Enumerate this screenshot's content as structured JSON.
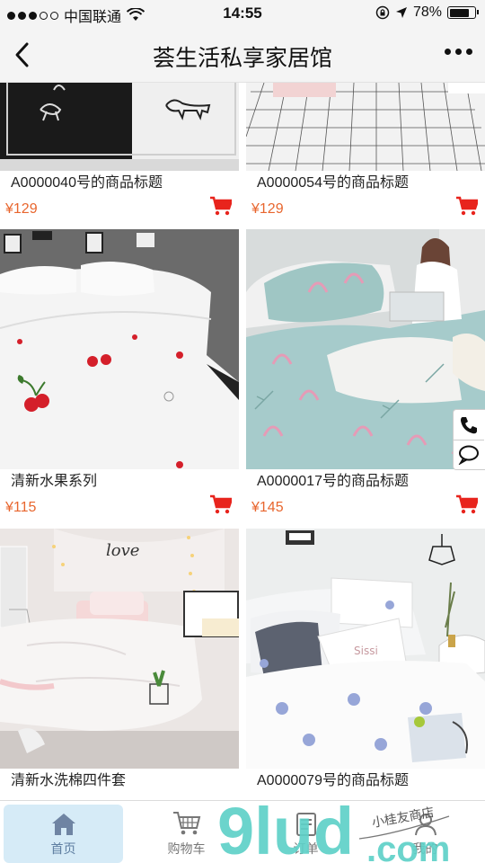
{
  "status_bar": {
    "carrier": "中国联通",
    "time": "14:55",
    "battery": "78%",
    "battery_level": 0.78
  },
  "nav": {
    "title": "荟生活私享家居馆"
  },
  "products": [
    {
      "title": "A0000040号的商品标题",
      "price": "¥129"
    },
    {
      "title": "A0000054号的商品标题",
      "price": "¥129"
    },
    {
      "title": "清新水果系列",
      "price": "¥115"
    },
    {
      "title": "A0000017号的商品标题",
      "price": "¥145"
    },
    {
      "title": "清新水洗棉四件套",
      "price": ""
    },
    {
      "title": "A0000079号的商品标题",
      "price": ""
    }
  ],
  "tabs": [
    {
      "label": "首页",
      "icon": "home-icon",
      "active": true
    },
    {
      "label": "购物车",
      "icon": "cart-icon",
      "active": false
    },
    {
      "label": "订单",
      "icon": "order-icon",
      "active": false
    },
    {
      "label": "我的",
      "icon": "user-icon",
      "active": false
    }
  ],
  "watermark": {
    "text": "9lud",
    "suffix": ".com",
    "handwriting": "小桂友商店"
  },
  "colors": {
    "price": "#e8662e",
    "cart": "#e8241d",
    "tab_active_bg": "#d6ebf7",
    "watermark": "#5fd1c8"
  }
}
